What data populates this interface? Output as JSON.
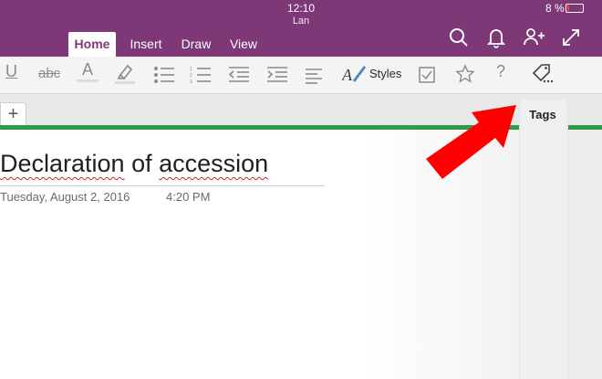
{
  "status": {
    "time": "12:10",
    "battery": "8 %"
  },
  "notebook": {
    "name": "Lan"
  },
  "tabs": [
    {
      "label": "Home",
      "active": true
    },
    {
      "label": "Insert",
      "active": false
    },
    {
      "label": "Draw",
      "active": false
    },
    {
      "label": "View",
      "active": false
    }
  ],
  "header_icons": [
    "search-icon",
    "bell-icon",
    "add-person-icon",
    "expand-icon"
  ],
  "ribbon": {
    "tools": [
      "underline-icon",
      "strikethrough-icon",
      "font-color-icon",
      "highlighter-icon",
      "bullets-icon",
      "numbering-icon",
      "outdent-icon",
      "indent-icon",
      "align-icon",
      "styles-icon",
      "checkbox-icon",
      "star-icon",
      "question-icon",
      "tag-icon"
    ],
    "underline_glyph": "U",
    "strike_glyph": "abc",
    "font_color_glyph": "A",
    "styles_label": "Styles",
    "question_glyph": "?"
  },
  "section": {
    "add_glyph": "+"
  },
  "page": {
    "title_part1": "Declaration",
    "title_part2": " of ",
    "title_part3": "accession",
    "date": "Tuesday, August 2, 2016",
    "time": "4:20 PM"
  },
  "tooltip": {
    "label": "Tags"
  },
  "colors": {
    "brand": "#7e3878",
    "section": "#2f9a49",
    "arrow": "#ff0000",
    "spell": "#d0232a"
  }
}
